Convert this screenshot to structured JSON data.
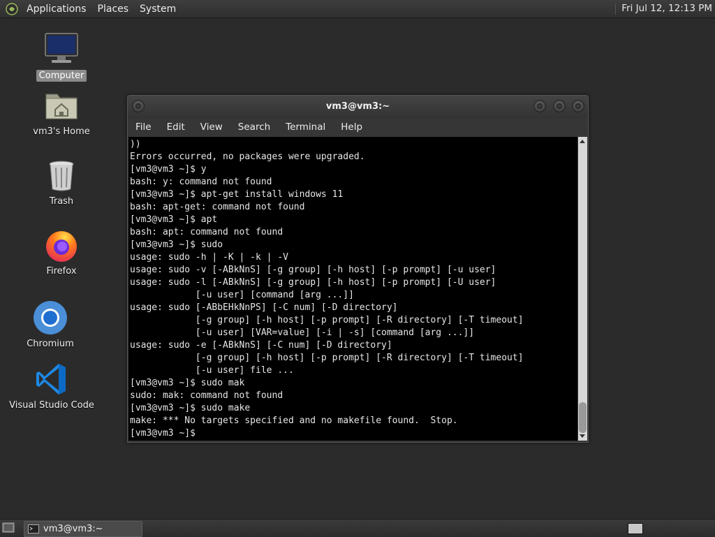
{
  "top_panel": {
    "menus": [
      "Applications",
      "Places",
      "System"
    ],
    "clock": "Fri Jul 12, 12:13 PM"
  },
  "desktop": {
    "icons": [
      {
        "label": "Computer",
        "icon": "computer-icon"
      },
      {
        "label": "vm3's Home",
        "icon": "home-folder-icon"
      },
      {
        "label": "Trash",
        "icon": "trash-icon"
      },
      {
        "label": "Firefox",
        "icon": "firefox-icon"
      },
      {
        "label": "Chromium",
        "icon": "chromium-icon"
      },
      {
        "label": "Visual Studio Code",
        "icon": "vscode-icon"
      }
    ]
  },
  "terminal": {
    "title": "vm3@vm3:~",
    "menu": [
      "File",
      "Edit",
      "View",
      "Search",
      "Terminal",
      "Help"
    ],
    "lines": [
      "))",
      "Errors occurred, no packages were upgraded.",
      "[vm3@vm3 ~]$ y",
      "bash: y: command not found",
      "[vm3@vm3 ~]$ apt-get install windows 11",
      "bash: apt-get: command not found",
      "[vm3@vm3 ~]$ apt",
      "bash: apt: command not found",
      "[vm3@vm3 ~]$ sudo",
      "usage: sudo -h | -K | -k | -V",
      "usage: sudo -v [-ABkNnS] [-g group] [-h host] [-p prompt] [-u user]",
      "usage: sudo -l [-ABkNnS] [-g group] [-h host] [-p prompt] [-U user]",
      "            [-u user] [command [arg ...]]",
      "usage: sudo [-ABbEHkNnPS] [-C num] [-D directory]",
      "            [-g group] [-h host] [-p prompt] [-R directory] [-T timeout]",
      "            [-u user] [VAR=value] [-i | -s] [command [arg ...]]",
      "usage: sudo -e [-ABkNnS] [-C num] [-D directory]",
      "            [-g group] [-h host] [-p prompt] [-R directory] [-T timeout]",
      "            [-u user] file ...",
      "[vm3@vm3 ~]$ sudo mak",
      "sudo: mak: command not found",
      "[vm3@vm3 ~]$ sudo make",
      "make: *** No targets specified and no makefile found.  Stop.",
      "[vm3@vm3 ~]$ "
    ]
  },
  "taskbar": {
    "task_label": "vm3@vm3:~"
  },
  "colors": {
    "desktop_bg": "#2b2b2b",
    "terminal_bg": "#000000",
    "terminal_fg": "#e6e6e6"
  }
}
